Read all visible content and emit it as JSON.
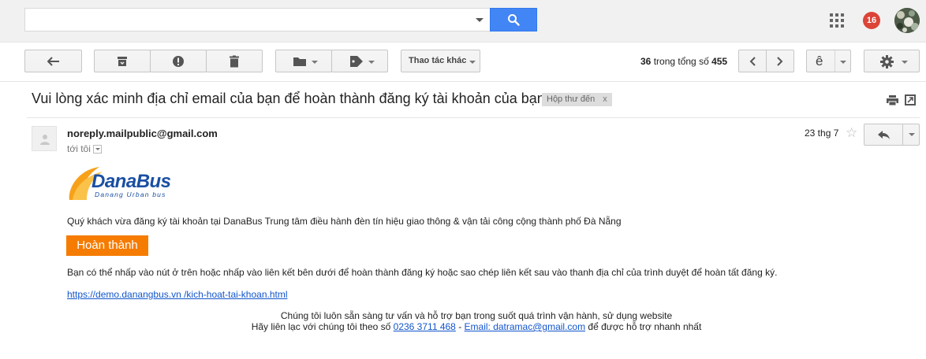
{
  "topbar": {
    "search_value": "",
    "notifications_count": "16",
    "apps_icon": "apps-grid-icon",
    "search_icon": "search-icon"
  },
  "toolbar": {
    "more_actions_label": "Thao tác khác",
    "pager": {
      "current": "36",
      "middle": " trong tổng số ",
      "total": "455"
    },
    "input_tool_label": "ê"
  },
  "message": {
    "subject": "Vui lòng xác minh địa chỉ email của bạn để hoàn thành đăng ký tài khoản của bạn",
    "label": "Hộp thư đến",
    "label_remove": "x",
    "sender": "noreply.mailpublic@gmail.com",
    "to": "tới tôi",
    "date": "23 thg 7"
  },
  "email_body": {
    "logo_text": "DanaBus",
    "logo_tagline": "Danang Urban bus",
    "intro": "Quý khách vừa đăng ký tài khoản tại DanaBus Trung tâm điều hành đèn tín hiệu giao thông & vận tải công cộng thành phố Đà Nẵng",
    "button_label": "Hoàn thành",
    "instruction": "Bạn có thể nhấp vào nút ở trên hoặc nhấp vào liên kết bên dưới để hoàn thành đăng ký hoặc sao chép liên kết sau vào thanh địa chỉ của trình duyệt để hoàn tất đăng ký.",
    "activation_link": "https://demo.danangbus.vn /kich-hoat-tai-khoan.html",
    "footer_line1": "Chúng tôi luôn sẵn sàng tư vấn và hỗ trợ bạn trong suốt quá trình vận hành, sử dụng website",
    "footer_prefix": "Hãy liên lạc với chúng tôi theo số ",
    "footer_phone": "0236 3711 468",
    "footer_sep": " - ",
    "footer_email": "Email: datramac@gmail.com",
    "footer_suffix": " để được hỗ trợ nhanh nhất"
  },
  "colors": {
    "search_button": "#4285f4",
    "badge": "#db4437",
    "cta": "#f57c00",
    "link": "#1155cc"
  }
}
